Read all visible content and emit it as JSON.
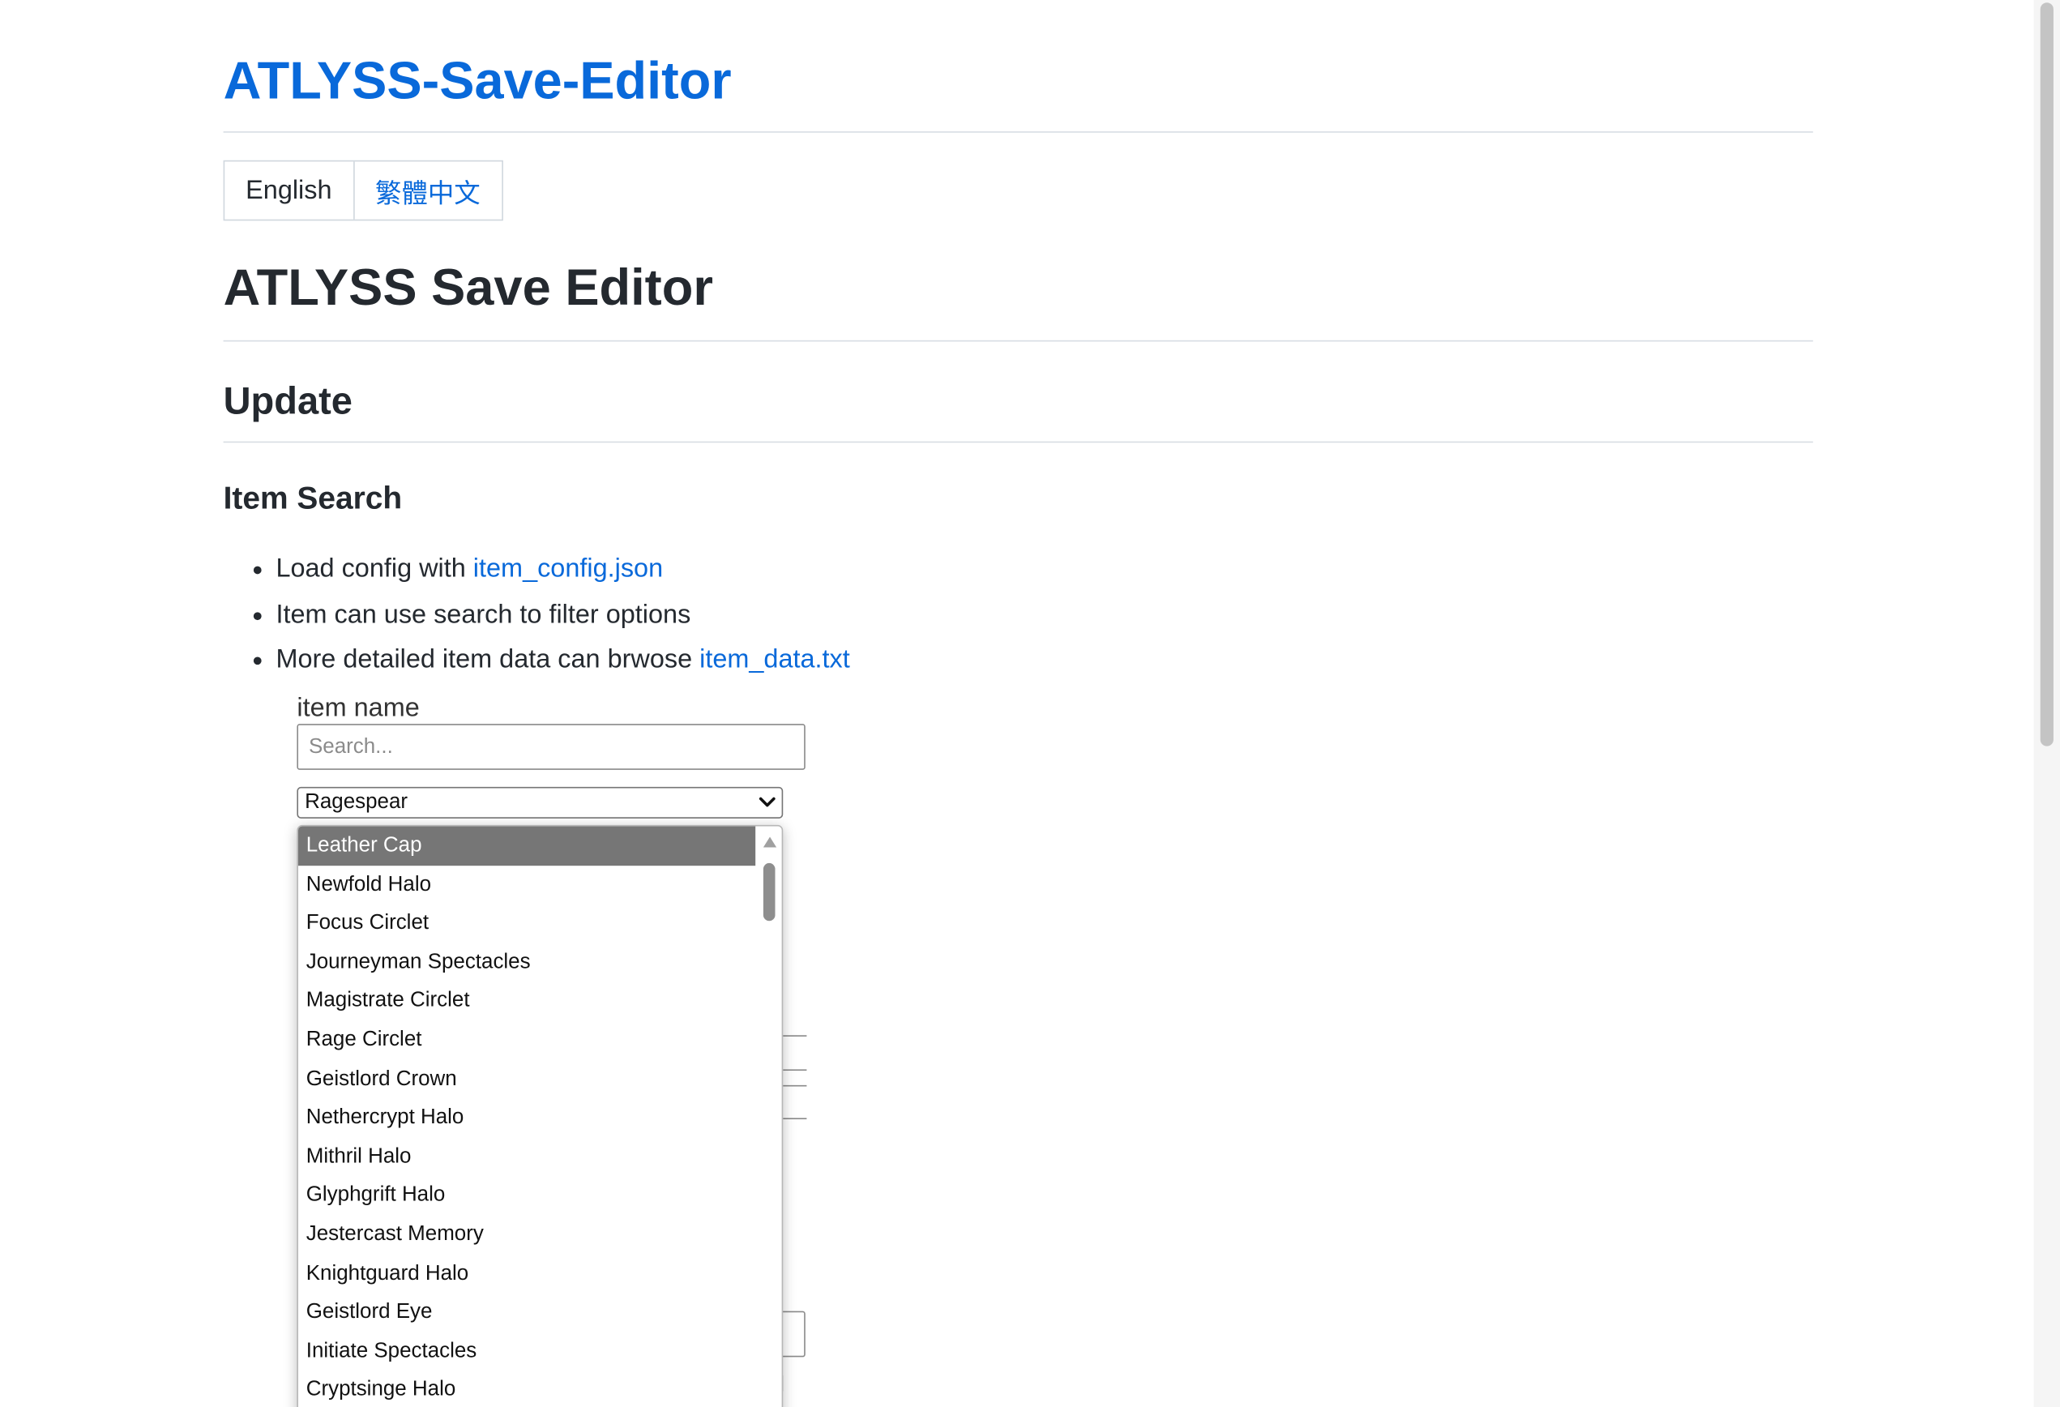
{
  "site": {
    "title": "ATLYSS-Save-Editor"
  },
  "languages": {
    "current": "English",
    "alternate": "繁體中文"
  },
  "page": {
    "title": "ATLYSS Save Editor"
  },
  "update_section": {
    "heading": "Update",
    "subheading": "Item Search",
    "bullets": [
      {
        "text": "Load config with ",
        "link": "item_config.json"
      },
      {
        "text": "Item can use search to filter options"
      },
      {
        "text": "More detailed item data can brwose ",
        "link": "item_data.txt"
      }
    ]
  },
  "item_demo": {
    "label": "item name",
    "search_placeholder": "Search...",
    "selected_value": "Ragespear",
    "options": [
      "Leather Cap",
      "Newfold Halo",
      "Focus Circlet",
      "Journeyman Spectacles",
      "Magistrate Circlet",
      "Rage Circlet",
      "Geistlord Crown",
      "Nethercrypt Halo",
      "Mithril Halo",
      "Glyphgrift Halo",
      "Jestercast Memory",
      "Knightguard Halo",
      "Geistlord Eye",
      "Initiate Spectacles",
      "Cryptsinge Halo"
    ],
    "highlighted_option": "Leather Cap"
  },
  "colors": {
    "link": "#0969da",
    "text": "#24292f",
    "option_highlight": "#767676"
  }
}
